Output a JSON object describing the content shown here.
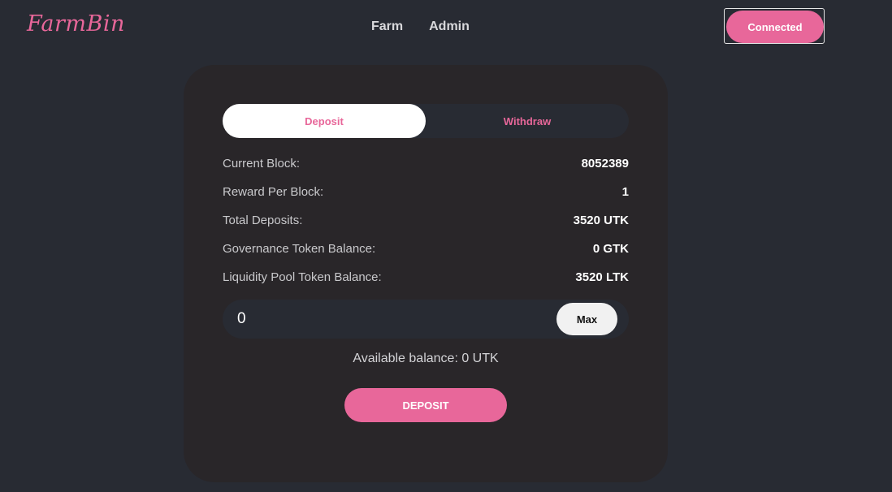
{
  "header": {
    "logo": "FarmBin",
    "nav": [
      {
        "label": "Farm"
      },
      {
        "label": "Admin"
      }
    ],
    "connect_label": "Connected"
  },
  "card": {
    "tabs": [
      {
        "label": "Deposit",
        "active": true
      },
      {
        "label": "Withdraw",
        "active": false
      }
    ],
    "stats": [
      {
        "label": "Current Block:",
        "value": "8052389"
      },
      {
        "label": "Reward Per Block:",
        "value": "1"
      },
      {
        "label": "Total Deposits:",
        "value": "3520 UTK"
      },
      {
        "label": "Governance Token Balance:",
        "value": "0 GTK"
      },
      {
        "label": "Liquidity Pool Token Balance:",
        "value": "3520 LTK"
      }
    ],
    "amount_value": "0",
    "max_label": "Max",
    "available_balance": "Available balance: 0 UTK",
    "submit_label": "DEPOSIT"
  },
  "colors": {
    "background": "#282b33",
    "card": "#292629",
    "accent": "#e8679a"
  }
}
